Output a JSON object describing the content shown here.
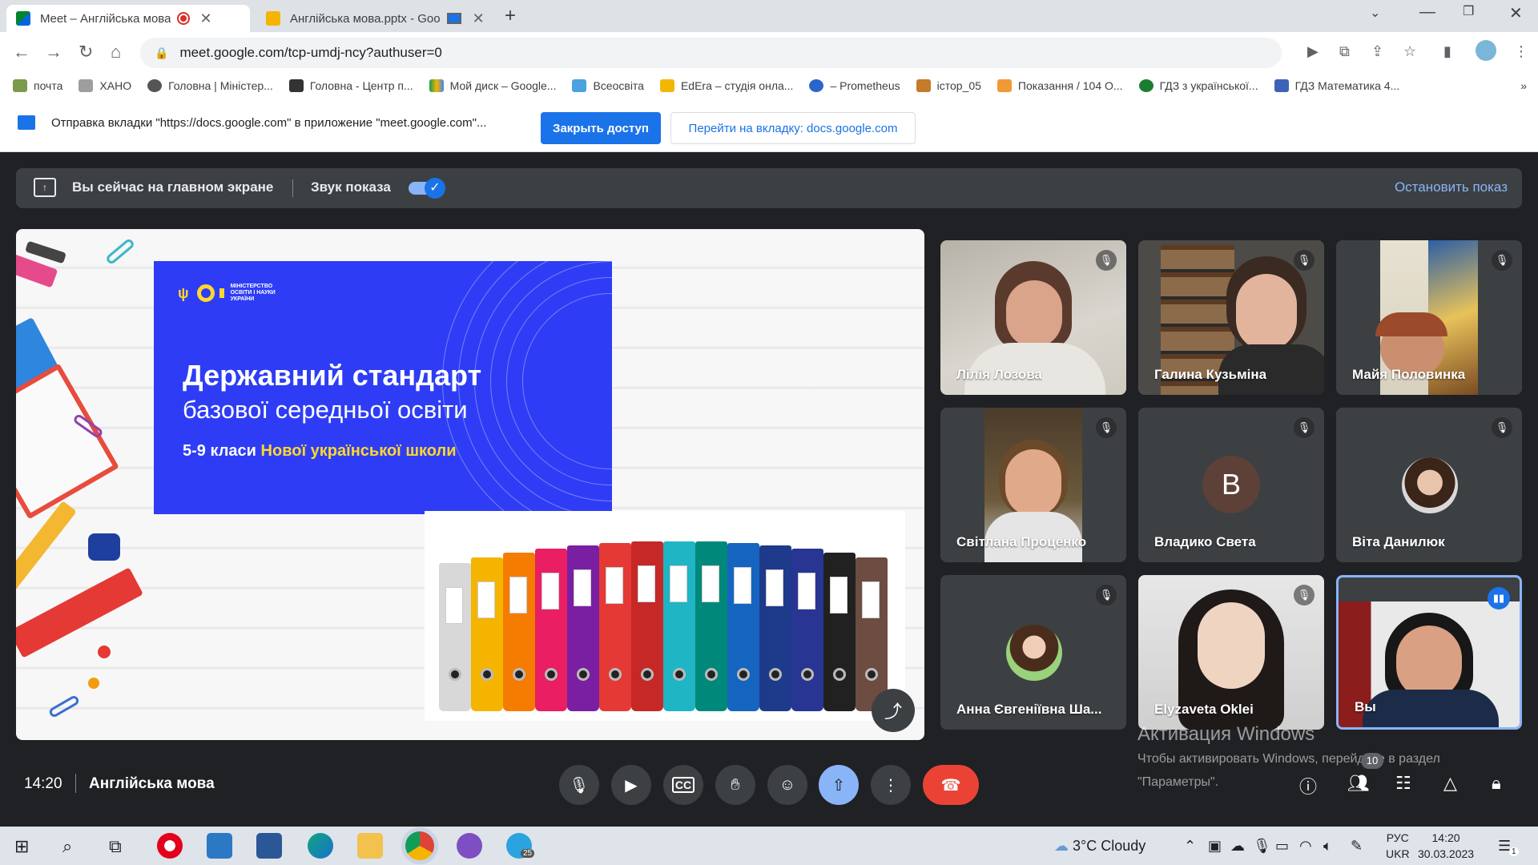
{
  "browser": {
    "tabs": [
      {
        "title": "Meet – Англійська мова",
        "active": true
      },
      {
        "title": "Англійська мова.pptx - Goo",
        "active": false
      }
    ],
    "url": "meet.google.com/tcp-umdj-ncy?authuser=0",
    "bookmarks": [
      "почта",
      "ХАНО",
      "Головна | Міністер...",
      "Головна - Центр п...",
      "Мой диск – Google...",
      "Всеосвіта",
      "EdEra – студія онла...",
      "– Prometheus",
      "істор_05",
      "Показання / 104 О...",
      "ГДЗ з української...",
      "ГДЗ Математика 4..."
    ],
    "more_bookmarks": "»"
  },
  "infobar": {
    "message": "Отправка вкладки \"https://docs.google.com\" в приложение \"meet.google.com\"...",
    "close_access_label": "Закрыть доступ",
    "goto_tab_label": "Перейти на вкладку: docs.google.com"
  },
  "present_banner": {
    "text": "Вы сейчас на главном экране",
    "audio_label": "Звук показа",
    "audio_enabled": true,
    "stop_label": "Остановить показ"
  },
  "slide": {
    "ministry": [
      "МІНІСТЕРСТВО",
      "ОСВІТИ І НАУКИ",
      "УКРАЇНИ"
    ],
    "title": "Державний стандарт",
    "subtitle": "базової середньої освіти",
    "grades": "5-9 класи",
    "grades_highlight": "Нової української школи"
  },
  "participants": [
    {
      "name": "Лілія Лозова",
      "muted": true
    },
    {
      "name": "Галина Кузьміна",
      "muted": true
    },
    {
      "name": "Майя Половинка",
      "muted": true
    },
    {
      "name": "Світлана Проценко",
      "muted": true
    },
    {
      "name": "Владико Света",
      "muted": true,
      "initial": "В"
    },
    {
      "name": "Віта Данилюк",
      "muted": true
    },
    {
      "name": "Анна Євгеніївна Ша...",
      "muted": true
    },
    {
      "name": "Elyzaveta Oklei",
      "muted": true
    },
    {
      "name": "Вы",
      "muted": false,
      "speaking": true
    }
  ],
  "meeting": {
    "time": "14:20",
    "title": "Англійська мова",
    "people_count": "10"
  },
  "activation": {
    "title": "Активация Windows",
    "line1": "Чтобы активировать Windows, перейдите в раздел",
    "line2": "\"Параметры\"."
  },
  "taskbar": {
    "weather": "3°C  Cloudy",
    "lang_top": "РУС",
    "lang_bottom": "UKR",
    "time": "14:20",
    "date": "30.03.2023",
    "telegram_badge": "25",
    "notifications": "1"
  },
  "colors": {
    "meet_bg": "#202124",
    "accent": "#1a73e8",
    "slide_blue": "#2e3df5",
    "slide_yellow": "#ffd82b",
    "end_call": "#ea4335"
  }
}
